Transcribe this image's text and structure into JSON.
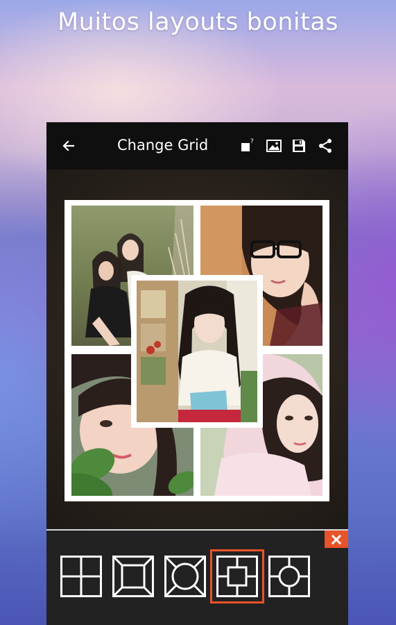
{
  "headline": "Muitos layouts bonitas",
  "toolbar": {
    "title": "Change Grid",
    "icons": [
      "back-arrow-icon",
      "resize-icon",
      "image-icon",
      "save-icon",
      "share-icon"
    ]
  },
  "collage": {
    "layout": "four-corners-with-center-square",
    "photos": [
      "two-girls-sitting-outdoors",
      "girl-with-glasses",
      "girl-holding-book",
      "girl-behind-leaves",
      "girl-in-pink-hoodie"
    ]
  },
  "grid_options": [
    {
      "name": "four-squares",
      "selected": false
    },
    {
      "name": "frame-with-corner-lines",
      "selected": false
    },
    {
      "name": "circle-with-corner-lines",
      "selected": false
    },
    {
      "name": "center-square-cross",
      "selected": true
    },
    {
      "name": "center-circle-cross",
      "selected": false
    }
  ],
  "colors": {
    "accent": "#e9532a",
    "toolbar": "#0f0f0f",
    "bottom_bar": "#222222"
  }
}
